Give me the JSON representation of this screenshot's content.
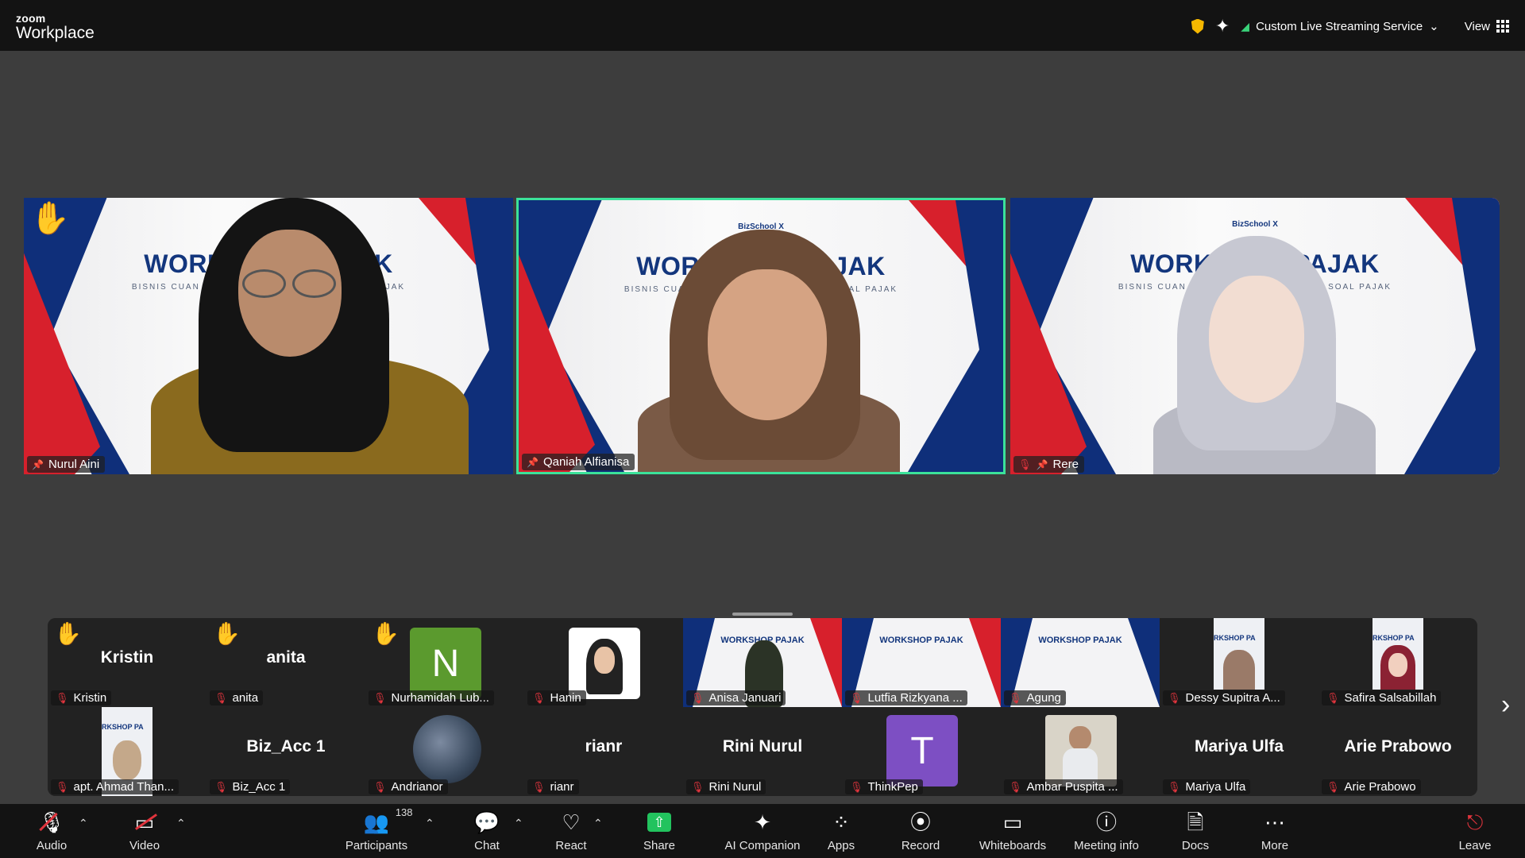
{
  "app": {
    "brand_small": "zoom",
    "brand_name": "Workplace"
  },
  "topbar": {
    "shield_icon": "shield-icon",
    "sparkle_icon": "ai-sparkle-icon",
    "stream_label": "Custom Live Streaming Service",
    "view_label": "View"
  },
  "slide": {
    "logo_text": "BizSchool X",
    "title": "WORKSHOP PAJAK",
    "subtitle": "BISNIS CUAN MAKSIMAL, TANPA DRAMA SOAL PAJAK"
  },
  "speakers": [
    {
      "name": "Nurul Aini",
      "hand_raised": true,
      "muted": false
    },
    {
      "name": "Qaniah Alfianisa",
      "hand_raised": false,
      "muted": false,
      "active": true
    },
    {
      "name": "Rere",
      "hand_raised": false,
      "muted": true
    }
  ],
  "gallery": {
    "row1": [
      {
        "display": "Kristin",
        "chip": "Kristin",
        "hand": true
      },
      {
        "display": "anita",
        "chip": "anita",
        "hand": true
      },
      {
        "display": "N",
        "chip": "Nurhamidah Lub...",
        "hand": true
      },
      {
        "display": "",
        "chip": "Hanin",
        "hand": false
      },
      {
        "display": "",
        "chip": "Anisa Januari",
        "hand": false
      },
      {
        "display": "",
        "chip": "Lutfia Rizkyana ...",
        "hand": false
      },
      {
        "display": "",
        "chip": "Agung",
        "hand": false
      },
      {
        "display": "",
        "chip": "Dessy Supitra A...",
        "hand": false
      },
      {
        "display": "",
        "chip": "Safira Salsabillah",
        "hand": false
      }
    ],
    "row2": [
      {
        "display": "",
        "chip": "apt. Ahmad Than..."
      },
      {
        "display": "Biz_Acc 1",
        "chip": "Biz_Acc 1"
      },
      {
        "display": "",
        "chip": "Andrianor"
      },
      {
        "display": "rianr",
        "chip": "rianr"
      },
      {
        "display": "Rini Nurul",
        "chip": "Rini Nurul"
      },
      {
        "display": "T",
        "chip": "ThinkPep"
      },
      {
        "display": "",
        "chip": "Ambar Puspita ..."
      },
      {
        "display": "Mariya Ulfa",
        "chip": "Mariya Ulfa"
      },
      {
        "display": "Arie Prabowo",
        "chip": "Arie Prabowo"
      }
    ],
    "mini_slide_title": "WORKSHOP PAJAK",
    "mini_slide_title_crop": "RKSHOP PA"
  },
  "toolbar": {
    "audio": "Audio",
    "video": "Video",
    "participants": "Participants",
    "participants_count": "138",
    "chat": "Chat",
    "react": "React",
    "share": "Share",
    "ai_companion": "AI Companion",
    "apps": "Apps",
    "record": "Record",
    "whiteboards": "Whiteboards",
    "meeting_info": "Meeting info",
    "docs": "Docs",
    "more": "More",
    "leave": "Leave"
  },
  "colors": {
    "active_speaker_border": "#3be29a",
    "muted_red": "#e0343d",
    "share_green": "#22c35e",
    "slide_blue": "#0f2f7a",
    "slide_red": "#d7202c"
  }
}
